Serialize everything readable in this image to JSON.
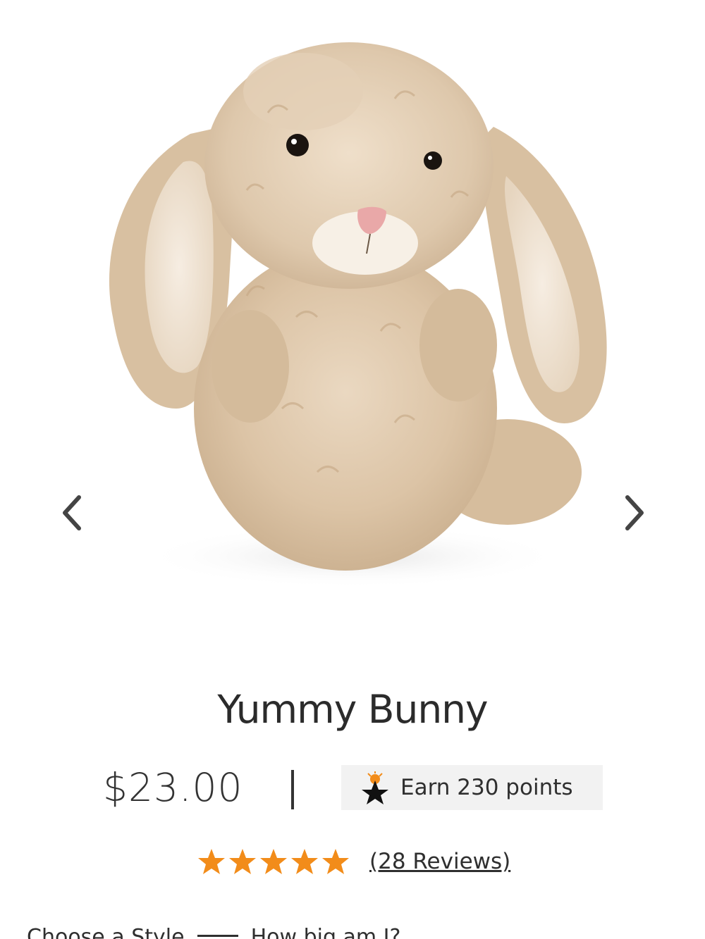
{
  "product": {
    "title": "Yummy Bunny",
    "price": "$23.00",
    "price_divider": "|",
    "points_label": "Earn 230 points",
    "rating_value": 5,
    "rating_max": 5,
    "reviews_label": "(28 Reviews)"
  },
  "gallery": {
    "prev_icon": "chevron-left-icon",
    "next_icon": "chevron-right-icon"
  },
  "options": {
    "style_label": "Choose a Style",
    "size_label": "How big am I?"
  },
  "colors": {
    "accent_star": "#f28c1a",
    "text": "#2b2b2b",
    "badge_bg": "#f2f2f2"
  }
}
